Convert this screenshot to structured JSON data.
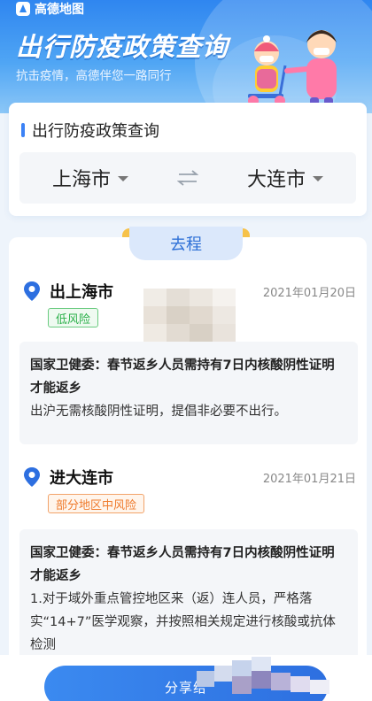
{
  "app": {
    "brand": "高德地图"
  },
  "hero": {
    "title": "出行防疫政策查询",
    "subtitle": "抗击疫情，高德伴您一路同行"
  },
  "query": {
    "section_title": "出行防疫政策查询",
    "from_city": "上海市",
    "to_city": "大连市"
  },
  "result": {
    "tab_label": "去程",
    "departure": {
      "title": "出上海市",
      "date": "2021年01月20日",
      "risk": "低风险",
      "notice_heading": "国家卫健委：春节返乡人员需持有7日内核酸阴性证明才能返乡",
      "notice_body": "出沪无需核酸阴性证明，提倡非必要不出行。"
    },
    "arrival": {
      "title": "进大连市",
      "date": "2021年01月21日",
      "risk": "部分地区中风险",
      "notice_heading": "国家卫健委：春节返乡人员需持有7日内核酸阴性证明才能返乡",
      "notice_body": "1.对于域外重点管控地区来（返）连人员，严格落实“14+7”医学观察，并按照相关规定进行核酸或抗体检测"
    }
  },
  "footer": {
    "share_label": "分享给"
  },
  "colors": {
    "accent": "#3b82f6",
    "low_risk": "#2bb04a",
    "mid_risk": "#ef7a2b"
  }
}
